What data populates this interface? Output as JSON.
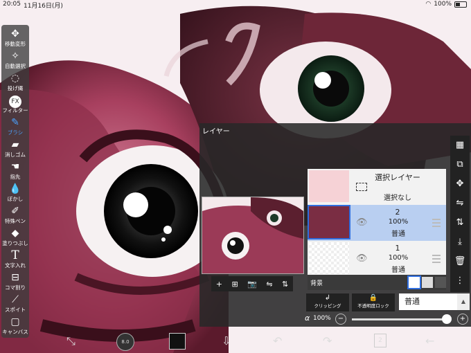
{
  "status_bar": {
    "time": "20:05",
    "date": "11月16日(月)",
    "battery": "100%"
  },
  "toolbar": {
    "tools": [
      {
        "label": "移動変形",
        "icon": "move-icon"
      },
      {
        "label": "自動選択",
        "icon": "magic-wand-icon"
      },
      {
        "label": "投げ縄",
        "icon": "lasso-icon"
      },
      {
        "label": "フィルター",
        "icon": "fx-icon"
      },
      {
        "label": "ブラシ",
        "icon": "brush-icon"
      },
      {
        "label": "消しゴム",
        "icon": "eraser-icon"
      },
      {
        "label": "指先",
        "icon": "smudge-icon"
      },
      {
        "label": "ぼかし",
        "icon": "blur-icon"
      },
      {
        "label": "特殊ペン",
        "icon": "special-pen-icon"
      },
      {
        "label": "塗りつぶし",
        "icon": "fill-icon"
      },
      {
        "label": "文字入れ",
        "icon": "text-icon"
      },
      {
        "label": "コマ割り",
        "icon": "frame-divider-icon"
      },
      {
        "label": "スポイト",
        "icon": "eyedropper-icon"
      },
      {
        "label": "キャンバス",
        "icon": "canvas-icon"
      }
    ],
    "fx_text": "FX",
    "t_text": "T",
    "active_tool": "ブラシ"
  },
  "layer_panel": {
    "title": "レイヤー",
    "selection_layer": {
      "name": "選択レイヤー",
      "status": "選択なし"
    },
    "layers": [
      {
        "number": "2",
        "opacity": "100%",
        "blend": "普通",
        "selected": true
      },
      {
        "number": "1",
        "opacity": "100%",
        "blend": "普通",
        "selected": false
      }
    ],
    "background_label": "背景",
    "clipping_label": "クリッピング",
    "alpha_lock_label": "不透明度ロック",
    "blend_mode": "普通",
    "alpha_symbol": "α",
    "alpha_value": "100%",
    "minus": "−",
    "plus": "+",
    "opacity_fraction": 1.0
  },
  "preview_tools": [
    "+",
    "⊞",
    "📷",
    "⇋",
    "⇅"
  ],
  "right_tools": [
    "▦",
    "⧉",
    "✥",
    "⇋",
    "⇅",
    "⤓",
    "🗑",
    "⋮"
  ],
  "bottom_bar": {
    "brush_size": "8.0",
    "layer_count": "2"
  },
  "colors": {
    "accent": "#2f6ee0",
    "panel": "#282828",
    "art_pink": "#b24a6a",
    "art_dark": "#5a1f2f"
  }
}
